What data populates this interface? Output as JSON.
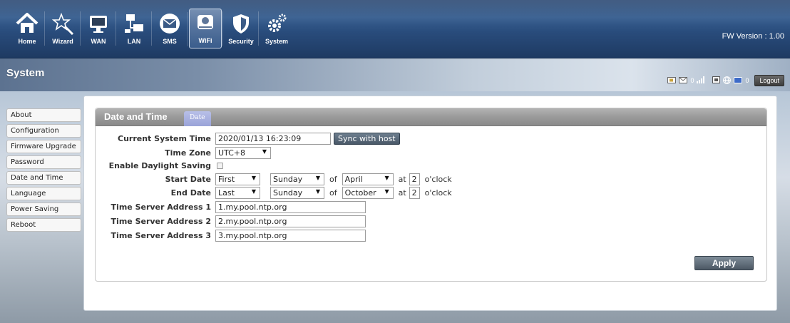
{
  "nav": {
    "items": [
      {
        "label": "Home",
        "icon": "home-icon"
      },
      {
        "label": "Wizard",
        "icon": "wand-icon"
      },
      {
        "label": "WAN",
        "icon": "monitor-icon"
      },
      {
        "label": "LAN",
        "icon": "network-icon"
      },
      {
        "label": "SMS",
        "icon": "envelope-icon"
      },
      {
        "label": "WiFi",
        "icon": "wifi-icon"
      },
      {
        "label": "Security",
        "icon": "shield-icon"
      },
      {
        "label": "System",
        "icon": "gears-icon"
      }
    ],
    "active": "WiFi"
  },
  "header": {
    "fw_version": "FW Version : 1.00",
    "section_title": "System"
  },
  "status": {
    "sms_count": "0",
    "wifi_count": "0",
    "logout_label": "Logout",
    "icons": [
      "sim-icon",
      "mail-icon",
      "signal-icon",
      "device-icon",
      "globe-icon",
      "wifi-clients-icon"
    ]
  },
  "sidebar": {
    "items": [
      {
        "label": "About"
      },
      {
        "label": "Configuration"
      },
      {
        "label": "Firmware Upgrade"
      },
      {
        "label": "Password"
      },
      {
        "label": "Date and Time"
      },
      {
        "label": "Language"
      },
      {
        "label": "Power Saving"
      },
      {
        "label": "Reboot"
      }
    ]
  },
  "panel": {
    "title": "Date and Time",
    "tab": "Date"
  },
  "form": {
    "current_time_label": "Current System Time",
    "current_time_value": "2020/01/13 16:23:09",
    "sync_label": "Sync with host",
    "timezone_label": "Time Zone",
    "timezone_value": "UTC+8",
    "dst_label": "Enable Daylight Saving",
    "dst_enabled": false,
    "start_label": "Start Date",
    "start_week": "First",
    "start_day": "Sunday",
    "start_month": "April",
    "start_hour": "2",
    "end_label": "End Date",
    "end_week": "Last",
    "end_day": "Sunday",
    "end_month": "October",
    "end_hour": "2",
    "of_text": "of",
    "at_text": "at",
    "oclock_text": "o'clock",
    "ts1_label": "Time Server Address 1",
    "ts1_value": "1.my.pool.ntp.org",
    "ts2_label": "Time Server Address 2",
    "ts2_value": "2.my.pool.ntp.org",
    "ts3_label": "Time Server Address 3",
    "ts3_value": "3.my.pool.ntp.org",
    "apply_label": "Apply"
  }
}
